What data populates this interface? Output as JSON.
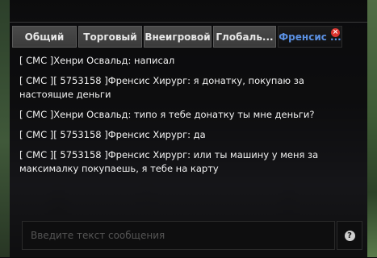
{
  "tabs": [
    {
      "label": "Общий",
      "active": false
    },
    {
      "label": "Торговый",
      "active": false
    },
    {
      "label": "Внеигровой",
      "active": false
    },
    {
      "label": "Глобаль...",
      "active": false
    },
    {
      "label": "Френсис ...",
      "active": true
    }
  ],
  "messages": [
    "[ СМС ]Хенри Освальд: написал",
    "[ СМС ][ 5753158 ]Френсис Хирург: я донатку, покупаю за настоящие деньги",
    "[ СМС ]Хенри Освальд: типо я тебе донатку ты мне деньги?",
    "[ СМС ][ 5753158 ]Френсис Хирург: да",
    "[ СМС ][ 5753158 ]Френсис Хирург: или ты машину у меня за максималку покупаешь, я тебе на карту"
  ],
  "input": {
    "placeholder": "Введите текст сообщения",
    "value": ""
  },
  "help_icon": "?",
  "close_icon": "×",
  "colors": {
    "active_tab_text": "#5a8fe0",
    "close_badge": "#d9332e"
  }
}
